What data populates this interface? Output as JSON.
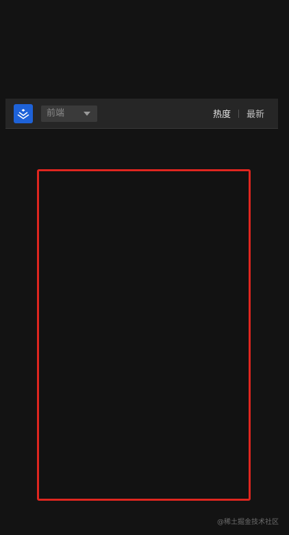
{
  "header": {
    "logo_icon": "juejin-logo-icon",
    "category": {
      "selected": "前端"
    },
    "sort_tabs": [
      {
        "label": "热度",
        "active": true
      },
      {
        "label": "最新",
        "active": false
      }
    ]
  },
  "watermark": "@稀土掘金技术社区",
  "colors": {
    "background": "#131313",
    "header_bg": "#262626",
    "logo_bg": "#1e62d8",
    "highlight_border": "#e0261f"
  }
}
